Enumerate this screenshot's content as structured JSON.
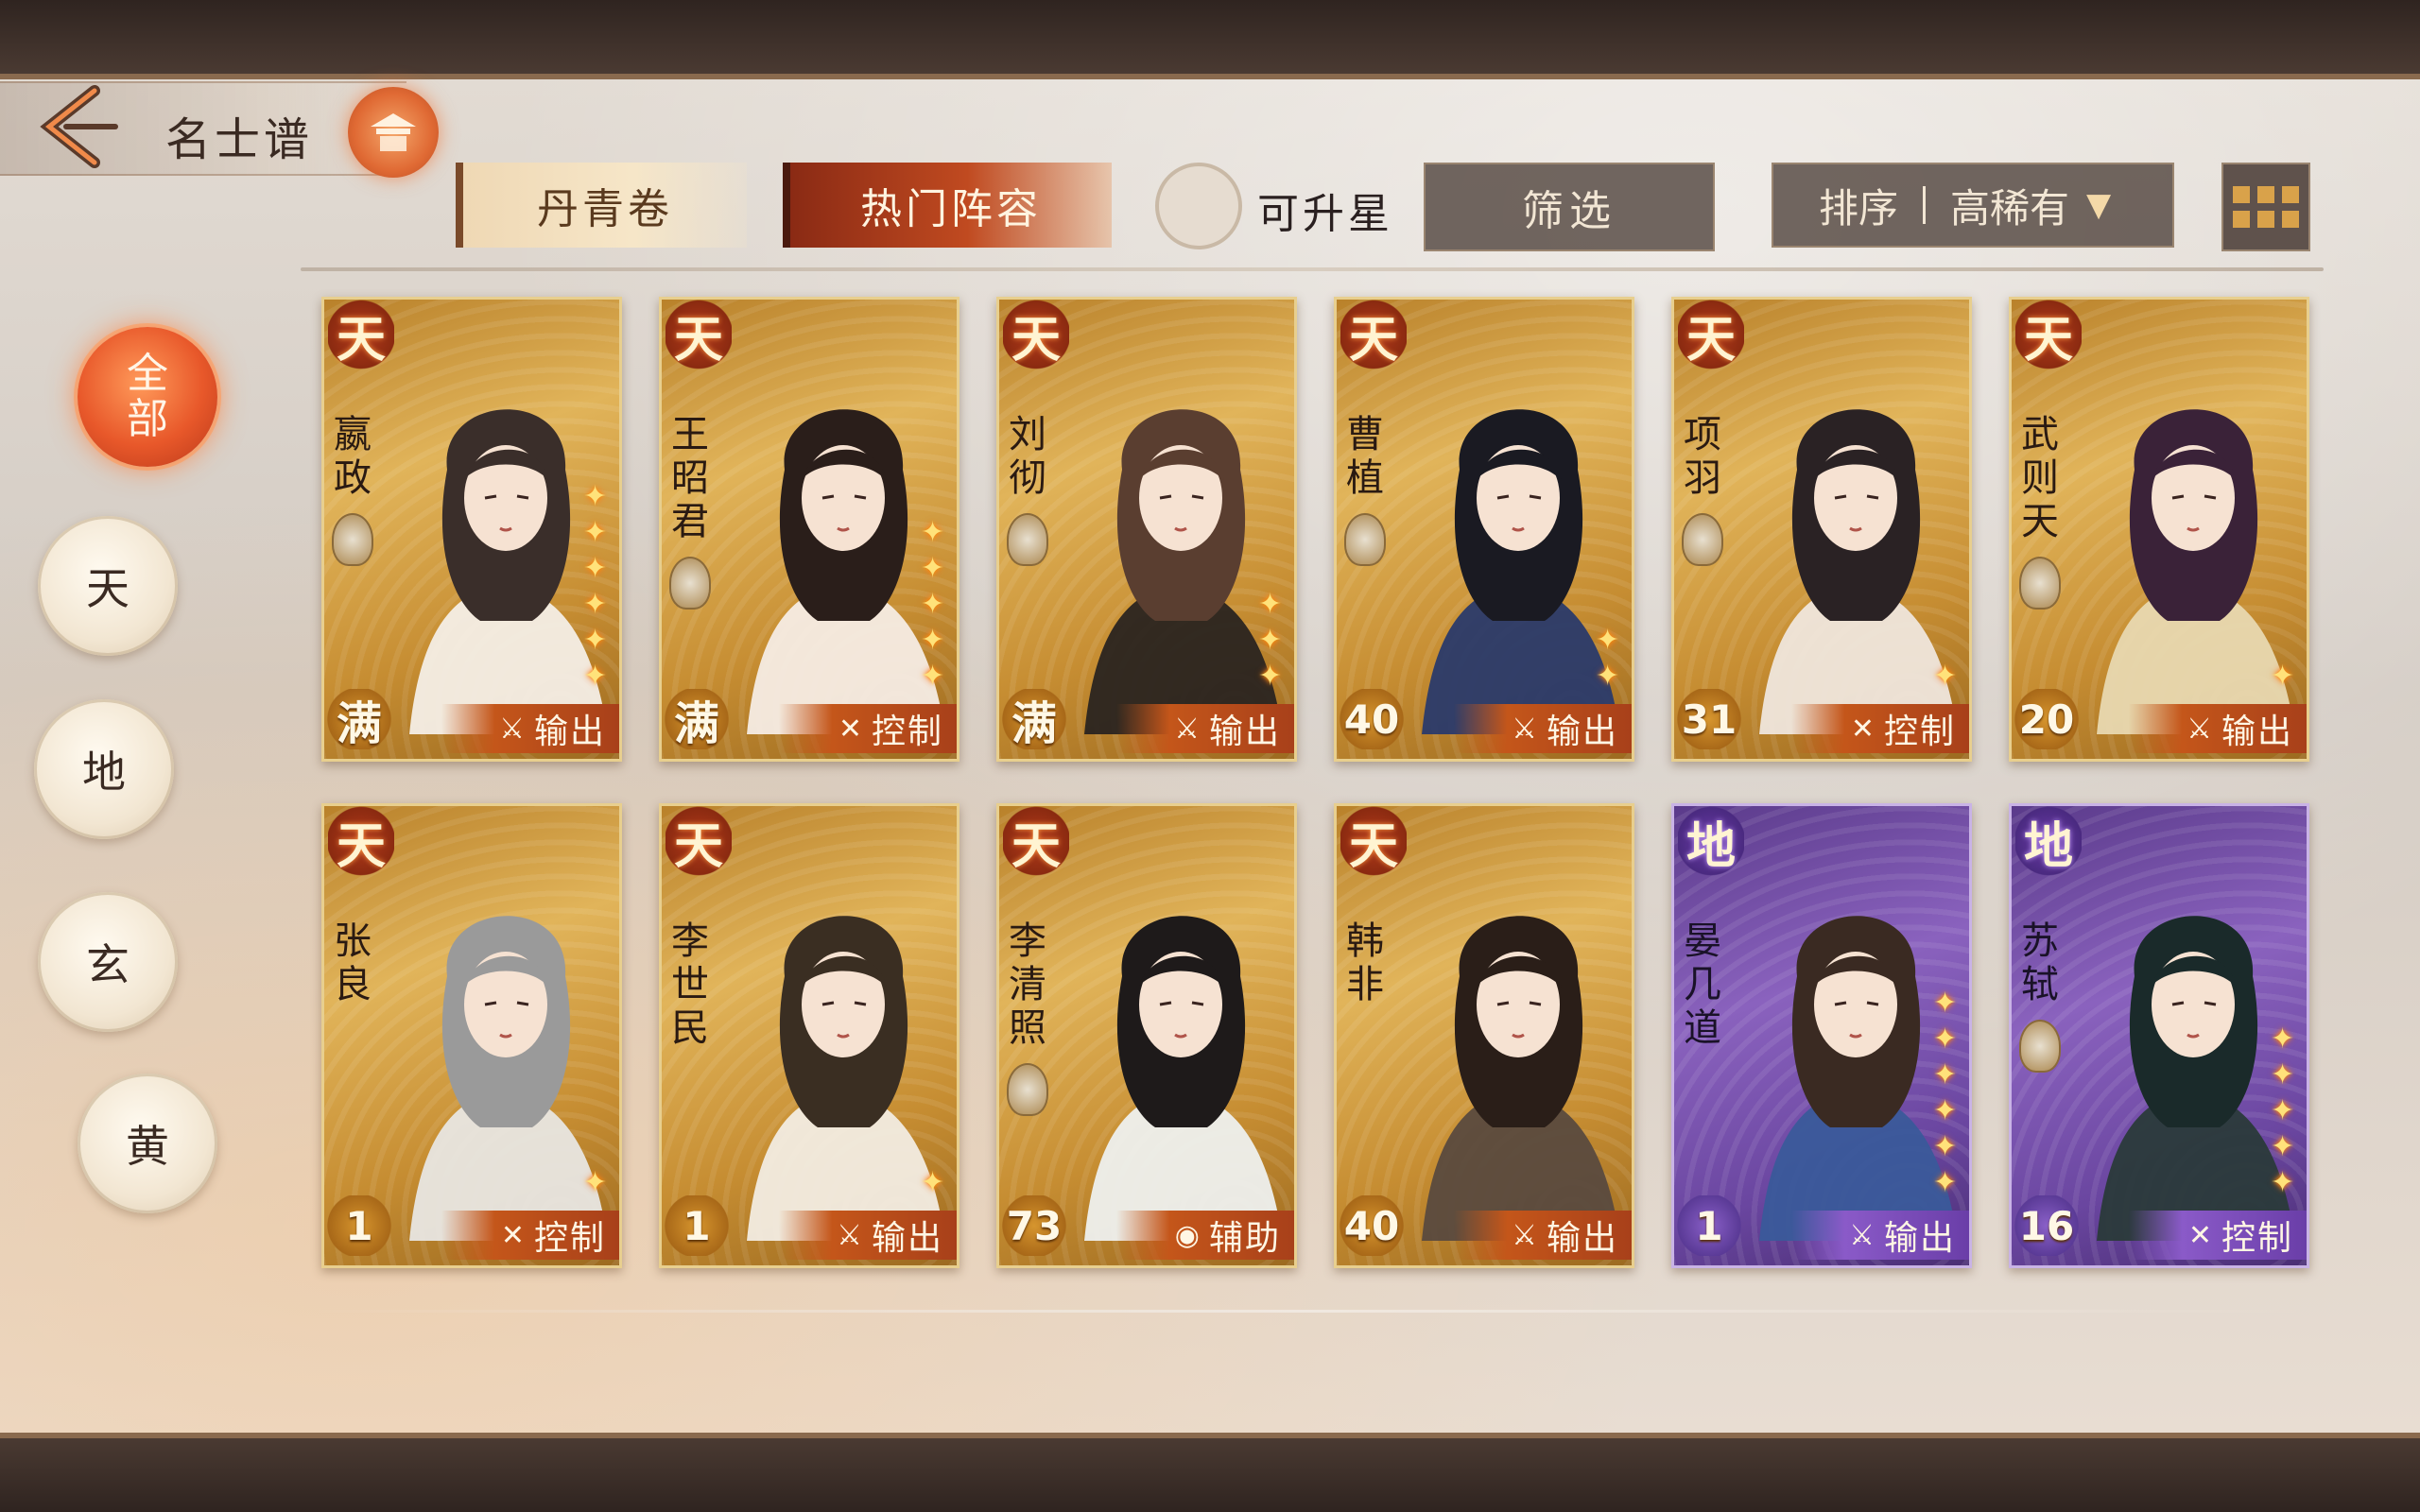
{
  "header": {
    "title": "名士谱",
    "back_icon": "back-arrow-icon",
    "emblem_icon": "palace-emblem-icon"
  },
  "tabs": [
    {
      "label": "丹青卷",
      "active": false
    },
    {
      "label": "热门阵容",
      "active": true
    }
  ],
  "toolbar": {
    "upstar_label": "可升星",
    "filter_label": "筛选",
    "sort_label": "排序",
    "sort_value": "高稀有",
    "grid_icon": "grid-view-icon"
  },
  "rank_filters": [
    {
      "label": "全部",
      "active": true
    },
    {
      "label": "天",
      "active": false
    },
    {
      "label": "地",
      "active": false
    },
    {
      "label": "玄",
      "active": false
    },
    {
      "label": "黄",
      "active": false
    }
  ],
  "cards": [
    {
      "name": "嬴政",
      "grade": "天",
      "level": "满",
      "role": "输出",
      "role_icon": "sword-icon",
      "stars": 6,
      "tier_color": "#c68d32",
      "faction_icon": "red-phoenix-faction-icon"
    },
    {
      "name": "王昭君",
      "grade": "天",
      "level": "满",
      "role": "控制",
      "role_icon": "crossed-swords-icon",
      "stars": 5,
      "tier_color": "#c68d32",
      "faction_icon": "purple-flower-faction-icon"
    },
    {
      "name": "刘彻",
      "grade": "天",
      "level": "满",
      "role": "输出",
      "role_icon": "sword-icon",
      "stars": 3,
      "tier_color": "#c68d32",
      "faction_icon": "white-beast-faction-icon"
    },
    {
      "name": "曹植",
      "grade": "天",
      "level": "40",
      "role": "输出",
      "role_icon": "sword-icon",
      "stars": 2,
      "tier_color": "#c68d32",
      "faction_icon": "white-beast-faction-icon"
    },
    {
      "name": "项羽",
      "grade": "天",
      "level": "31",
      "role": "控制",
      "role_icon": "crossed-swords-icon",
      "stars": 1,
      "tier_color": "#c68d32",
      "faction_icon": "spear-faction-icon"
    },
    {
      "name": "武则天",
      "grade": "天",
      "level": "20",
      "role": "输出",
      "role_icon": "sword-icon",
      "stars": 1,
      "tier_color": "#c68d32",
      "faction_icon": "blue-wave-faction-icon"
    },
    {
      "name": "张良",
      "grade": "天",
      "level": "1",
      "role": "控制",
      "role_icon": "crossed-swords-icon",
      "stars": 1,
      "tier_color": "#c68d32",
      "faction_icon": ""
    },
    {
      "name": "李世民",
      "grade": "天",
      "level": "1",
      "role": "输出",
      "role_icon": "sword-icon",
      "stars": 1,
      "tier_color": "#c68d32",
      "faction_icon": ""
    },
    {
      "name": "李清照",
      "grade": "天",
      "level": "73",
      "role": "辅助",
      "role_icon": "support-orb-icon",
      "stars": 0,
      "tier_color": "#c68d32",
      "faction_icon": "green-crest-faction-icon"
    },
    {
      "name": "韩非",
      "grade": "天",
      "level": "40",
      "role": "输出",
      "role_icon": "sword-icon",
      "stars": 0,
      "tier_color": "#c68d32",
      "faction_icon": ""
    },
    {
      "name": "晏几道",
      "grade": "地",
      "level": "1",
      "role": "输出",
      "role_icon": "sword-icon",
      "stars": 6,
      "tier_color": "#8a62be",
      "faction_icon": ""
    },
    {
      "name": "苏轼",
      "grade": "地",
      "level": "16",
      "role": "控制",
      "role_icon": "crossed-swords-icon",
      "stars": 5,
      "tier_color": "#8a62be",
      "faction_icon": "spear-faction-icon"
    }
  ]
}
